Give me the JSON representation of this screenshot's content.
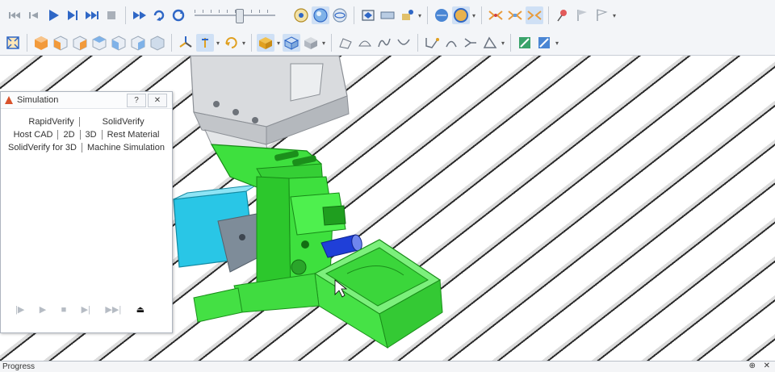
{
  "simulation_panel": {
    "title": "Simulation",
    "help_label": "?",
    "close_label": "✕",
    "tab_rows": [
      [
        "RapidVerify",
        "SolidVerify"
      ],
      [
        "Host CAD",
        "2D",
        "3D",
        "Rest Material"
      ],
      [
        "SolidVerify for 3D",
        "Machine Simulation"
      ]
    ],
    "playback": [
      "|▶",
      "▶",
      "■",
      "▶|",
      "▶▶|",
      "⏏"
    ]
  },
  "bottom_panel": {
    "label": "Progress",
    "pin_label": "⊕",
    "close_label": "✕"
  },
  "toolbar": {
    "speed_level": 0.55
  },
  "colors": {
    "machine_green": "#3ee03e",
    "spindle_gray": "#d7d9dc",
    "vise_cyan": "#29c6e6",
    "tool_blue": "#1f3fd8",
    "stock_green": "#4bea4b"
  }
}
